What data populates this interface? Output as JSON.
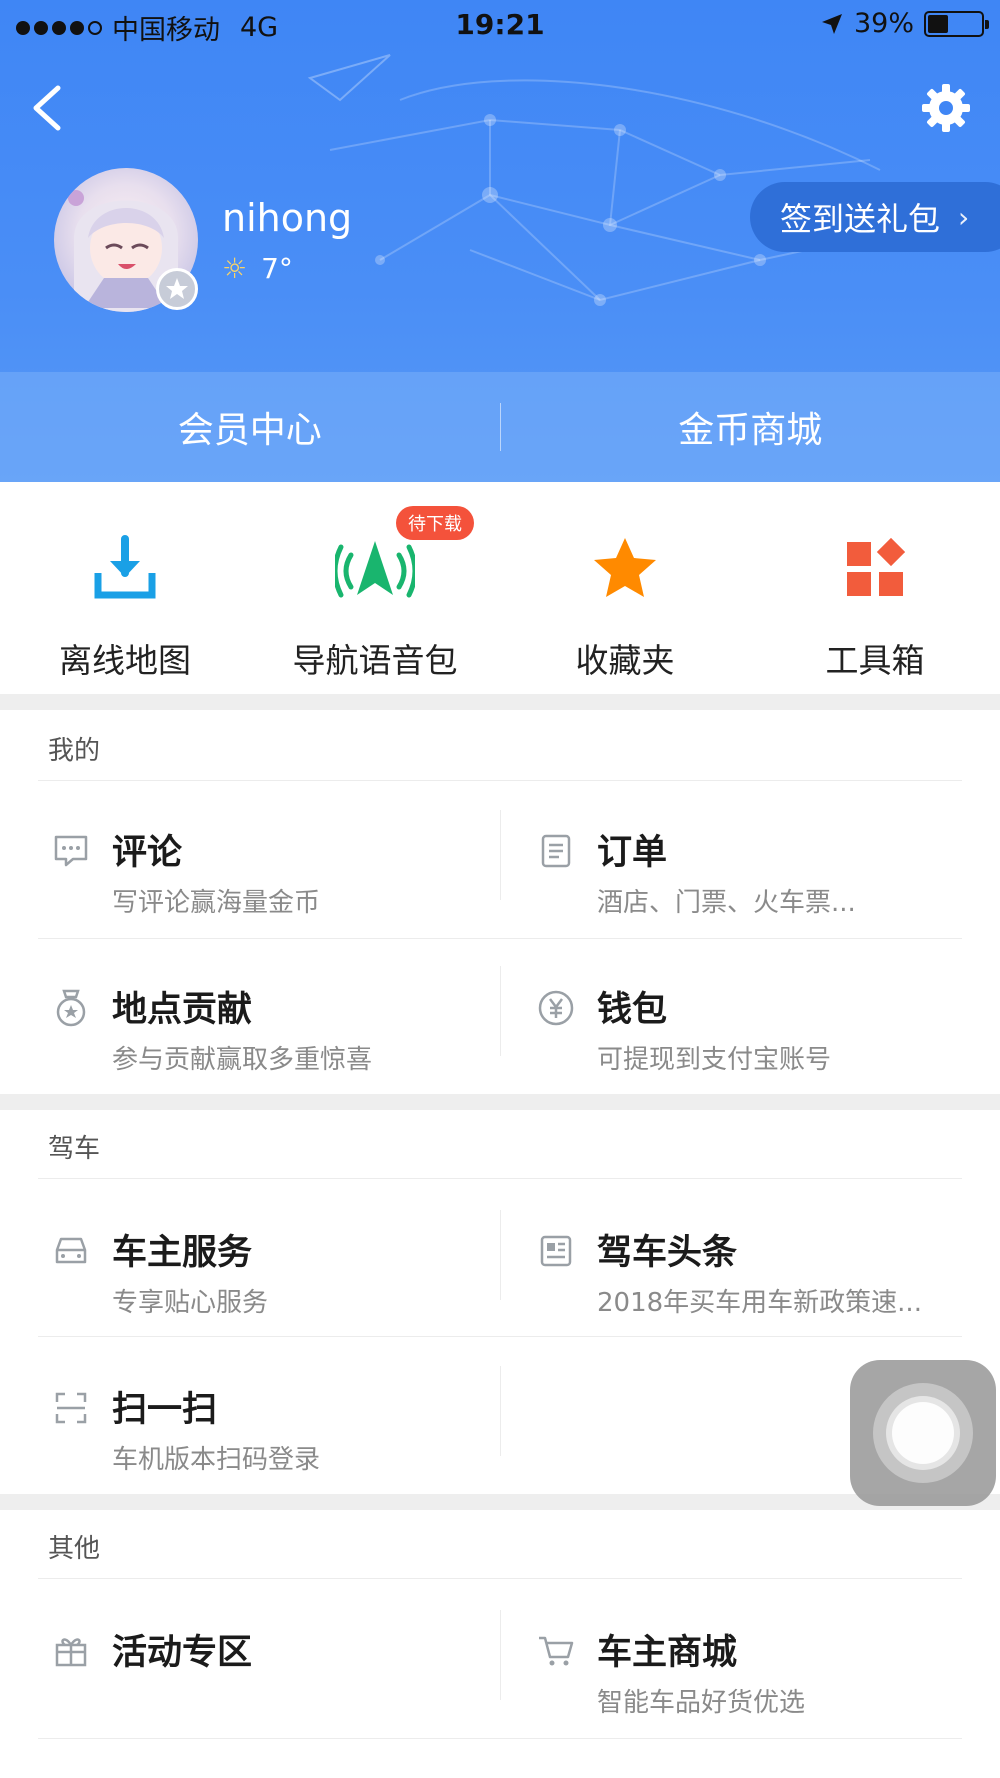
{
  "status_bar": {
    "carrier": "中国移动",
    "network": "4G",
    "time": "19:21",
    "battery": "39%",
    "battery_level": 0.39
  },
  "header": {
    "username": "nihong",
    "weather_temp": "7°",
    "signin_label": "签到送礼包",
    "tabs": [
      "会员中心",
      "金币商城"
    ]
  },
  "quick_actions": [
    {
      "label": "离线地图",
      "icon": "download-icon",
      "color": "#1aa0e6"
    },
    {
      "label": "导航语音包",
      "icon": "navigation-voice-icon",
      "color": "#19b56e",
      "badge": "待下载"
    },
    {
      "label": "收藏夹",
      "icon": "star-icon",
      "color": "#ff8a00"
    },
    {
      "label": "工具箱",
      "icon": "toolbox-icon",
      "color": "#f25c3c"
    }
  ],
  "sections": {
    "mine": {
      "title": "我的",
      "items": [
        {
          "title": "评论",
          "subtitle": "写评论赢海量金币",
          "icon": "comment-icon"
        },
        {
          "title": "订单",
          "subtitle": "酒店、门票、火车票...",
          "icon": "order-icon"
        },
        {
          "title": "地点贡献",
          "subtitle": "参与贡献赢取多重惊喜",
          "icon": "medal-icon"
        },
        {
          "title": "钱包",
          "subtitle": "可提现到支付宝账号",
          "icon": "yen-icon"
        }
      ]
    },
    "driving": {
      "title": "驾车",
      "items": [
        {
          "title": "车主服务",
          "subtitle": "专享贴心服务",
          "icon": "car-icon"
        },
        {
          "title": "驾车头条",
          "subtitle": "2018年买车用车新政策速...",
          "icon": "news-icon"
        },
        {
          "title": "扫一扫",
          "subtitle": "车机版本扫码登录",
          "icon": "scan-icon"
        }
      ]
    },
    "other": {
      "title": "其他",
      "items": [
        {
          "title": "活动专区",
          "subtitle": "",
          "icon": "gift-icon"
        },
        {
          "title": "车主商城",
          "subtitle": "智能车品好货优选",
          "icon": "cart-icon"
        }
      ]
    }
  },
  "colors": {
    "header_blue": "#3f86f5",
    "signin_bg": "#2f6fd8",
    "badge_red": "#f4523b"
  }
}
